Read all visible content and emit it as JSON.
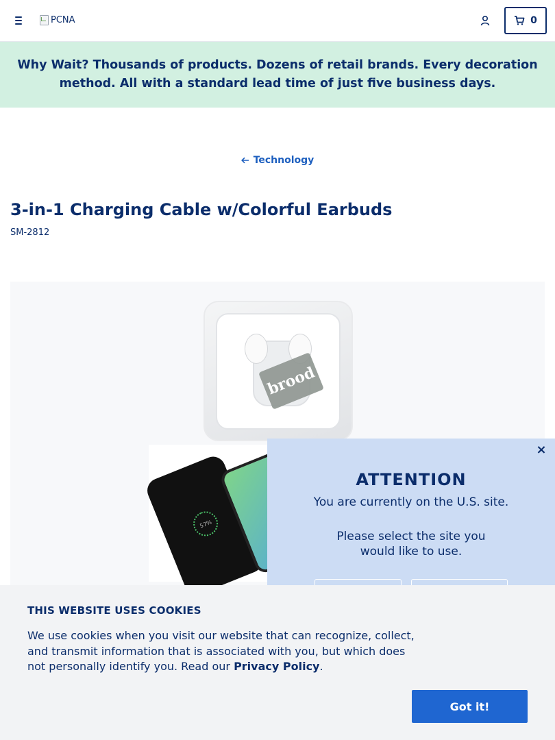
{
  "header": {
    "menu_icon": "hamburger-menu-icon",
    "logo_alt": "PCNA",
    "account_icon": "user-icon",
    "cart_icon": "shopping-cart-icon",
    "cart_count": "0"
  },
  "banner": {
    "lead": "Why Wait?",
    "text": "Thousands of products. Dozens of retail brands. Every decoration method. All with a standard lead time of just five business days.",
    "background": "#d2f0e1"
  },
  "breadcrumb": {
    "icon": "arrow-left-icon",
    "label": "Technology"
  },
  "product": {
    "title": "3-in-1 Charging Cable w/Colorful Earbuds",
    "sku": "SM-2812",
    "image_brand_text": "brood",
    "phone_screen_text": "57%"
  },
  "site_modal": {
    "close_label": "×",
    "heading": "ATTENTION",
    "line1": "You are currently on the U.S. site.",
    "line2a": "Please select the site you",
    "line2b": "would like to use.",
    "background": "#ccdcf4"
  },
  "cookie": {
    "title": "THIS WEBSITE USES COOKIES",
    "text": "We use cookies when you visit our website that can recognize, collect, and transmit information that is associated with you, but which does not personally identify you. Read our",
    "link": "Privacy Policy",
    "period": ".",
    "button": "Got it!",
    "button_color": "#1f66d1"
  }
}
